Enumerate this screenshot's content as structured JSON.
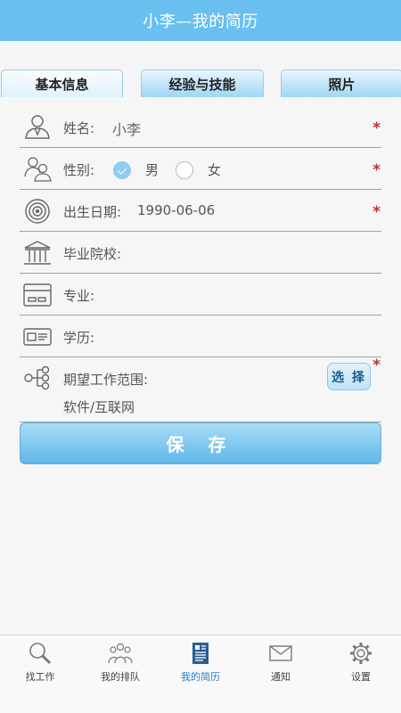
{
  "header": {
    "title": "小李—我的简历"
  },
  "tabs": [
    {
      "label": "基本信息",
      "active": true
    },
    {
      "label": "经验与技能",
      "active": false
    },
    {
      "label": "照片",
      "active": false
    }
  ],
  "form": {
    "name": {
      "label": "姓名:",
      "value": "小李",
      "required": "*"
    },
    "gender": {
      "label": "性别:",
      "options": [
        "男",
        "女"
      ],
      "selected": "男",
      "required": "*"
    },
    "birthday": {
      "label": "出生日期:",
      "value": "1990-06-06",
      "required": "*"
    },
    "school": {
      "label": "毕业院校:",
      "value": ""
    },
    "major": {
      "label": "专业:",
      "value": ""
    },
    "education": {
      "label": "学历:",
      "value": ""
    },
    "expected_scope": {
      "label": "期望工作范围:",
      "value": "软件/互联网",
      "select_label": "选 择",
      "required": "*"
    }
  },
  "save_label": "保 存",
  "bottom_nav": [
    {
      "label": "找工作",
      "icon": "search-icon",
      "active": false
    },
    {
      "label": "我的排队",
      "icon": "people-icon",
      "active": false
    },
    {
      "label": "我的简历",
      "icon": "resume-icon",
      "active": true
    },
    {
      "label": "通知",
      "icon": "mail-icon",
      "active": false
    },
    {
      "label": "设置",
      "icon": "gear-icon",
      "active": false
    }
  ],
  "colors": {
    "header": "#69bff0",
    "accent": "#2a7dbd",
    "required": "#c0312b"
  }
}
